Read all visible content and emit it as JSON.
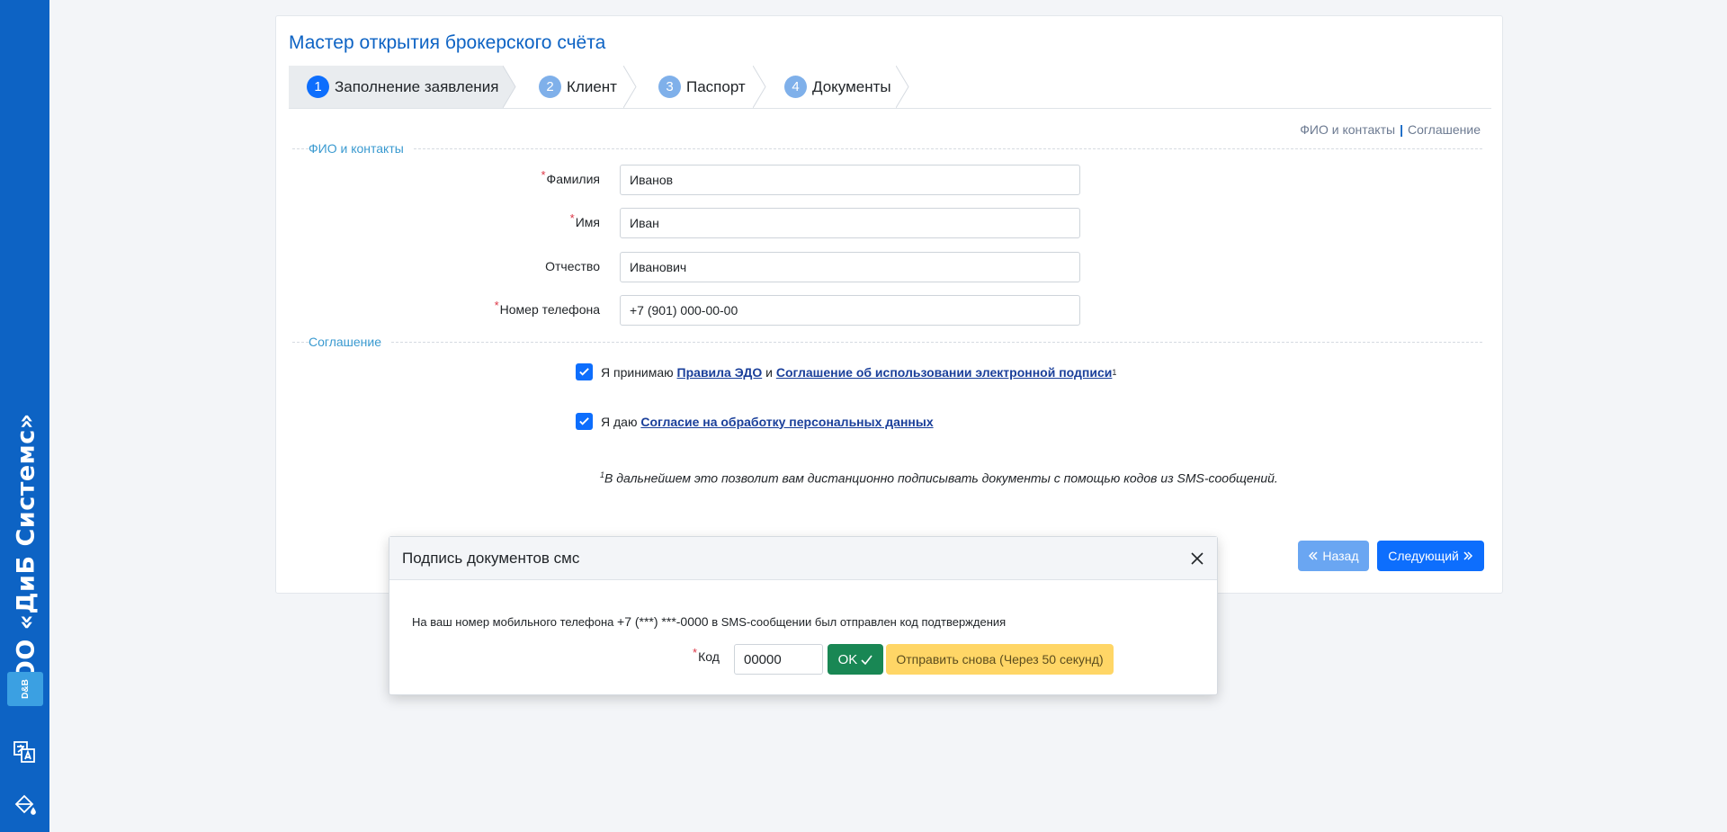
{
  "sidebar": {
    "company": "ООО «ДиБ Системс»",
    "logo_text": "D&B",
    "icons": [
      "translate-icon",
      "paint-bucket-icon"
    ]
  },
  "card": {
    "title": "Мастер открытия брокерского счёта",
    "steps": [
      {
        "num": "1",
        "label": "Заполнение заявления",
        "active": true
      },
      {
        "num": "2",
        "label": "Клиент",
        "active": false
      },
      {
        "num": "3",
        "label": "Паспорт",
        "active": false
      },
      {
        "num": "4",
        "label": "Документы",
        "active": false
      }
    ],
    "quick_links": [
      "ФИО и контакты",
      "Соглашение"
    ],
    "sections": {
      "contacts": "ФИО и контакты",
      "agreement": "Соглашение"
    },
    "fields": {
      "last_name": {
        "label": "Фамилия",
        "value": "Иванов",
        "required": true
      },
      "first_name": {
        "label": "Имя",
        "value": "Иван",
        "required": true
      },
      "middle_name": {
        "label": "Отчество",
        "value": "Иванович",
        "required": false
      },
      "phone": {
        "label": "Номер телефона",
        "value": "+7 (901) 000-00-00",
        "required": true
      }
    },
    "agreements": {
      "edo_prefix": "Я принимаю",
      "edo_link": "Правила ЭДО",
      "edo_and": "и",
      "esign_link": "Соглашение об использовании электронной подписи",
      "edo_sup": "1",
      "personal_prefix": "Я даю",
      "personal_link": "Согласие на обработку персональных данных"
    },
    "footnote": {
      "sup": "1",
      "text": "В дальнейшем это позволит вам дистанционно подписывать документы с помощью кодов из SMS-сообщений."
    },
    "buttons": {
      "back": "Назад",
      "next": "Следующий"
    }
  },
  "modal": {
    "title": "Подпись документов смс",
    "text_before": "На ваш номер мобильного телефона",
    "masked_phone": "+7 (***) ***-0000",
    "text_after": "в SMS-сообщении был отправлен код подтверждения",
    "code_label": "Код",
    "code_value": "00000",
    "ok_label": "OK",
    "resend_label": "Отправить снова (Через 50 секунд)"
  },
  "colors": {
    "primary": "#0d6efd",
    "sidebar": "#0d63c4",
    "success": "#198754",
    "warning": "#ffd666"
  }
}
